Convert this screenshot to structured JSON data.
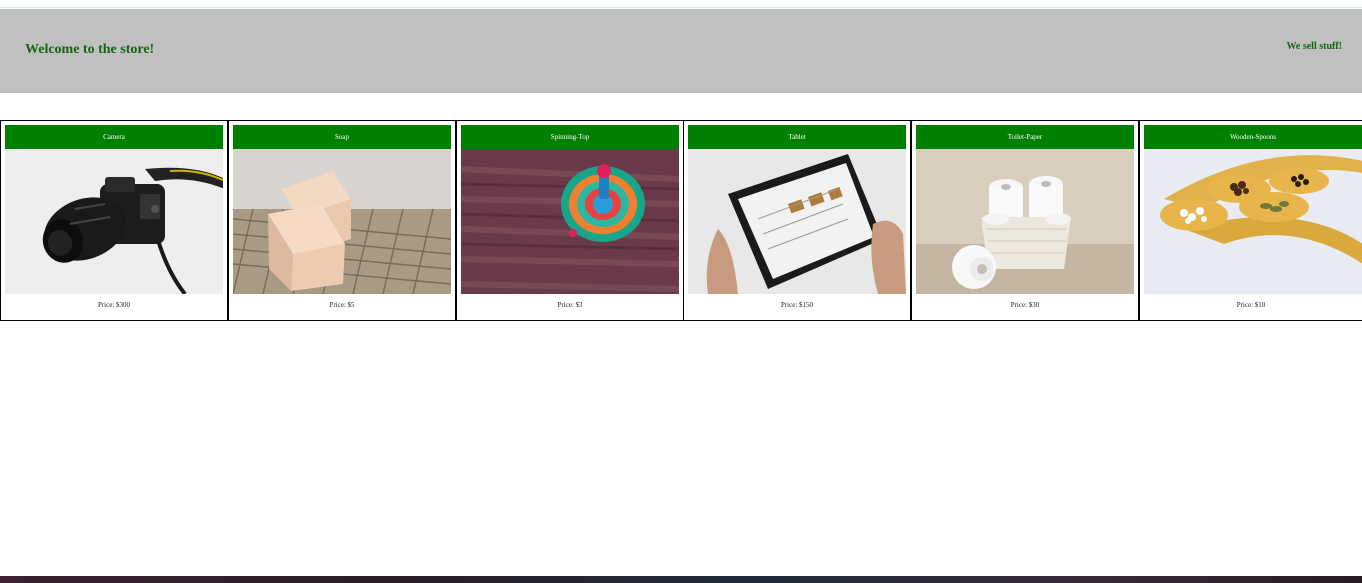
{
  "header": {
    "title": "Welcome to the store!",
    "tagline": "We sell stuff!",
    "background": "#c0c0c0",
    "text_color": "#116611"
  },
  "products": [
    {
      "name": "Camera",
      "price": "Price: $300",
      "image": "camera-photo"
    },
    {
      "name": "Soap",
      "price": "Price: $5",
      "image": "soap-photo"
    },
    {
      "name": "Spinning-Top",
      "price": "Price: $3",
      "image": "spinning-top-photo"
    },
    {
      "name": "Tablet",
      "price": "Price: $150",
      "image": "tablet-photo"
    },
    {
      "name": "Toilet-Paper",
      "price": "Price: $30",
      "image": "toilet-paper-photo"
    },
    {
      "name": "Wooden-Spoons",
      "price": "Price: $10",
      "image": "wooden-spoons-photo"
    }
  ],
  "colors": {
    "card_title_bg": "#008000",
    "card_title_text": "#ffffff",
    "card_border": "#000000"
  }
}
